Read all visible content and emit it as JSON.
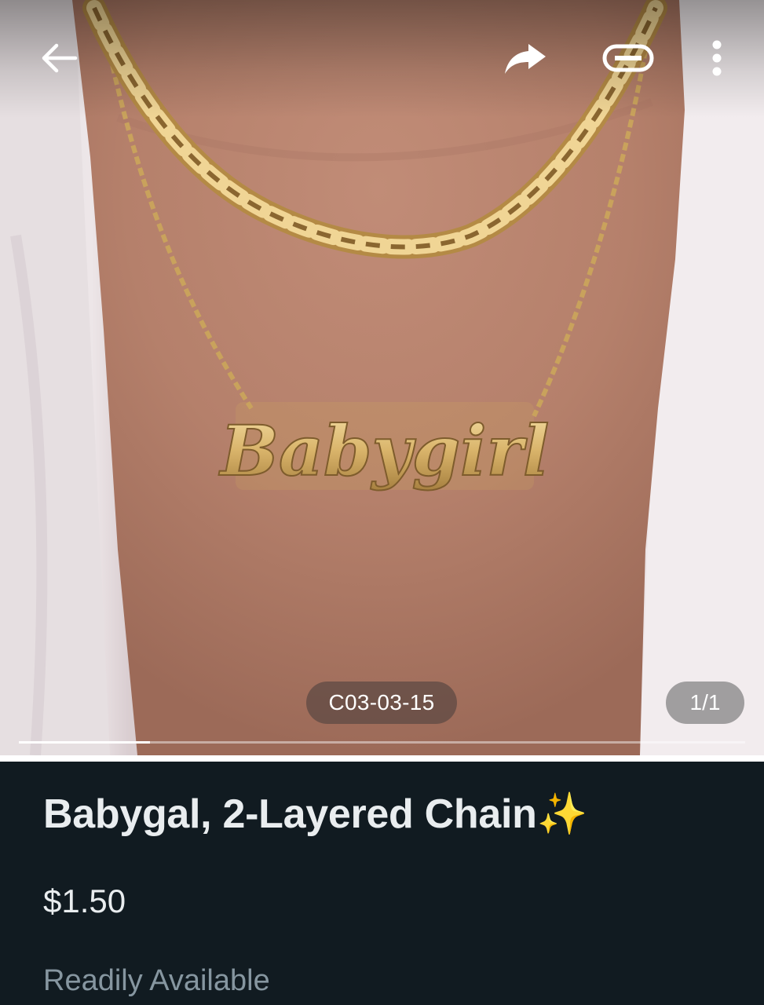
{
  "header": {
    "back_icon": "arrow-left-icon",
    "share_icon": "forward-arrow-icon",
    "link_icon": "link-icon",
    "more_icon": "more-vertical-icon"
  },
  "photo": {
    "pendant_text": "Babygirl",
    "code": "C03-03-15",
    "counter": "1/1",
    "progress_fraction": 0.18
  },
  "product": {
    "title": "Babygal, 2-Layered Chain",
    "title_emoji": "✨",
    "price": "$1.50",
    "availability": "Readily Available"
  },
  "colors": {
    "panel_bg": "#111b21",
    "title_text": "#e9edef",
    "secondary_text": "#8696a0",
    "gold": "#d9b46a",
    "skin": "#b88470"
  }
}
